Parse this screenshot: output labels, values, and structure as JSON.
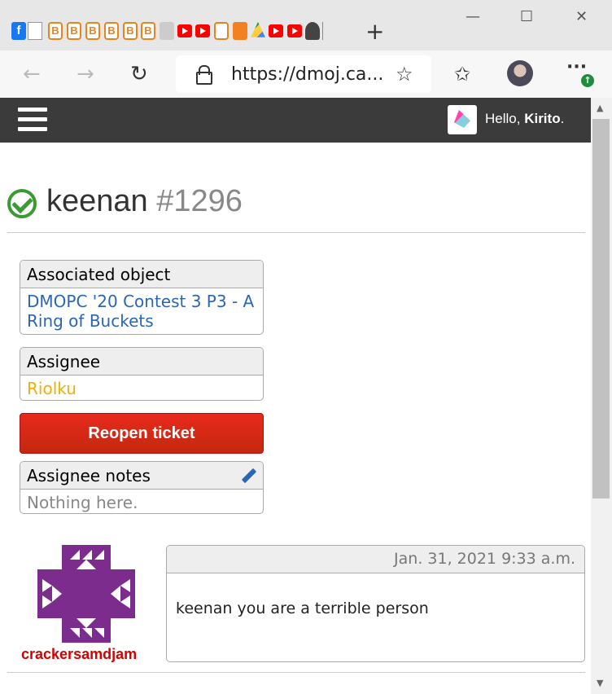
{
  "browser": {
    "url": "https://dmoj.ca...",
    "back_icon": "←",
    "forward_icon": "→",
    "reload_icon": "↻",
    "new_tab_icon": "+",
    "minimize_icon": "—",
    "maximize_icon": "☐",
    "close_icon": "✕",
    "more_icon": "···",
    "update_icon": "↑",
    "favorite_star_icon": "☆",
    "favorites_icon": "✩"
  },
  "site": {
    "greeting": "Hello, ",
    "username": "Kirito",
    "greeting_end": "."
  },
  "ticket": {
    "title": "keenan",
    "number": "#1296",
    "associated_object_label": "Associated object",
    "associated_object": "DMOPC '20 Contest 3 P3 - A Ring of Buckets",
    "assignee_label": "Assignee",
    "assignee": "Riolku",
    "reopen_label": "Reopen ticket",
    "notes_label": "Assignee notes",
    "notes": "Nothing here."
  },
  "comment": {
    "author": "crackersamdjam",
    "timestamp": "Jan. 31, 2021 9:33 a.m.",
    "body": "keenan you are a terrible person"
  },
  "colors": {
    "navbar": "#3b3b3b",
    "link": "#2a66b6",
    "assignee": "#f1b000",
    "reopen": "#d8281a",
    "author": "#d50000",
    "success": "#3a9b34",
    "avatar": "#7b2c8c"
  }
}
